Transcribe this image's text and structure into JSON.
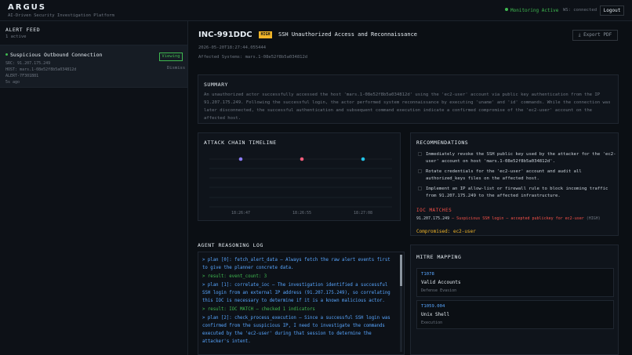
{
  "header": {
    "brand": "ARGUS",
    "tagline": "AI-Driven Security Investigation Platform",
    "status": "Monitoring Active",
    "connection": "WS: connected",
    "logout_label": "Logout"
  },
  "sidebar": {
    "title": "ALERT FEED",
    "count": "1 active",
    "alerts": [
      {
        "title": "Suspicious Outbound Connection",
        "src": "SRC: 91.207.175.249",
        "host": "HOST: mars.1-08e52f8b5a034812d",
        "alert_id": "ALERT-7F301B81",
        "age": "5s ago",
        "status_label": "Viewing",
        "dismiss_label": "Dismiss"
      }
    ]
  },
  "incident": {
    "id": "INC-991DDC",
    "severity": "HIGH",
    "title": "SSH Unauthorized Access and Reconnaissance",
    "export_label": "Export PDF",
    "timestamp": "2026-05-20T18:27:44.055444",
    "affected": "Affected Systems: mars.1-08e52f8b5a034812d"
  },
  "summary": {
    "title": "SUMMARY",
    "text": "An unauthorized actor successfully accessed the host 'mars.1-08e52f8b5a034812d' using the 'ec2-user' account via public key authentication from the IP 91.207.175.249. Following the successful login, the actor performed system reconnaissance by executing 'uname' and 'id' commands. While the connection was later disconnected, the successful authentication and subsequent command execution indicate a confirmed compromise of the 'ec2-user' account on the affected host."
  },
  "timeline": {
    "title": "ATTACK CHAIN TIMELINE",
    "events": [
      {
        "label": "18:26:47",
        "color": "#8b7cf6"
      },
      {
        "label": "18:26:55",
        "color": "#f25c7a"
      },
      {
        "label": "18:27:08",
        "color": "#22c3e6"
      }
    ]
  },
  "recommendations": {
    "title": "RECOMMENDATIONS",
    "items": [
      "Immediately revoke the SSH public key used by the attacker for the 'ec2-user' account on host 'mars.1-08e52f8b5a034812d'.",
      "Rotate credentials for the 'ec2-user' account and audit all authorized_keys files on the affected host.",
      "Implement an IP allow-list or firewall rule to block incoming traffic from 91.207.175.249 to the affected infrastructure."
    ],
    "ioc_title": "IOC MATCHES",
    "ioc": {
      "ip": "91.207.175.249",
      "desc": " — Suspicious SSH login — accepted publickey for ec2-user",
      "severity": " (HIGH)"
    },
    "compromised": "Compromised: ec2-user"
  },
  "reasoning": {
    "title": "AGENT REASONING LOG",
    "lines": [
      {
        "type": "plan",
        "text": "> plan [0]: fetch_alert_data — Always fetch the raw alert events first to give the planner concrete data."
      },
      {
        "type": "result",
        "text": "> result: event_count: 3"
      },
      {
        "type": "plan",
        "text": "> plan [1]: correlate_ioc — The investigation identified a successful SSH login from an external IP address (91.207.175.249), so correlating this IOC is necessary to determine if it is a known malicious actor."
      },
      {
        "type": "result",
        "text": "> result: IOC MATCH — checked 1 indicators"
      },
      {
        "type": "plan",
        "text": "> plan [2]: check_process_execution — Since a successful SSH login was confirmed from the suspicious IP, I need to investigate the commands executed by the 'ec2-user' during that session to determine the attacker's intent."
      }
    ]
  },
  "mitre": {
    "title": "MITRE MAPPING",
    "techniques": [
      {
        "id": "T1078",
        "name": "Valid Accounts",
        "tactic": "Defense Evasion"
      },
      {
        "id": "T1059.004",
        "name": "Unix Shell",
        "tactic": "Execution"
      }
    ]
  }
}
